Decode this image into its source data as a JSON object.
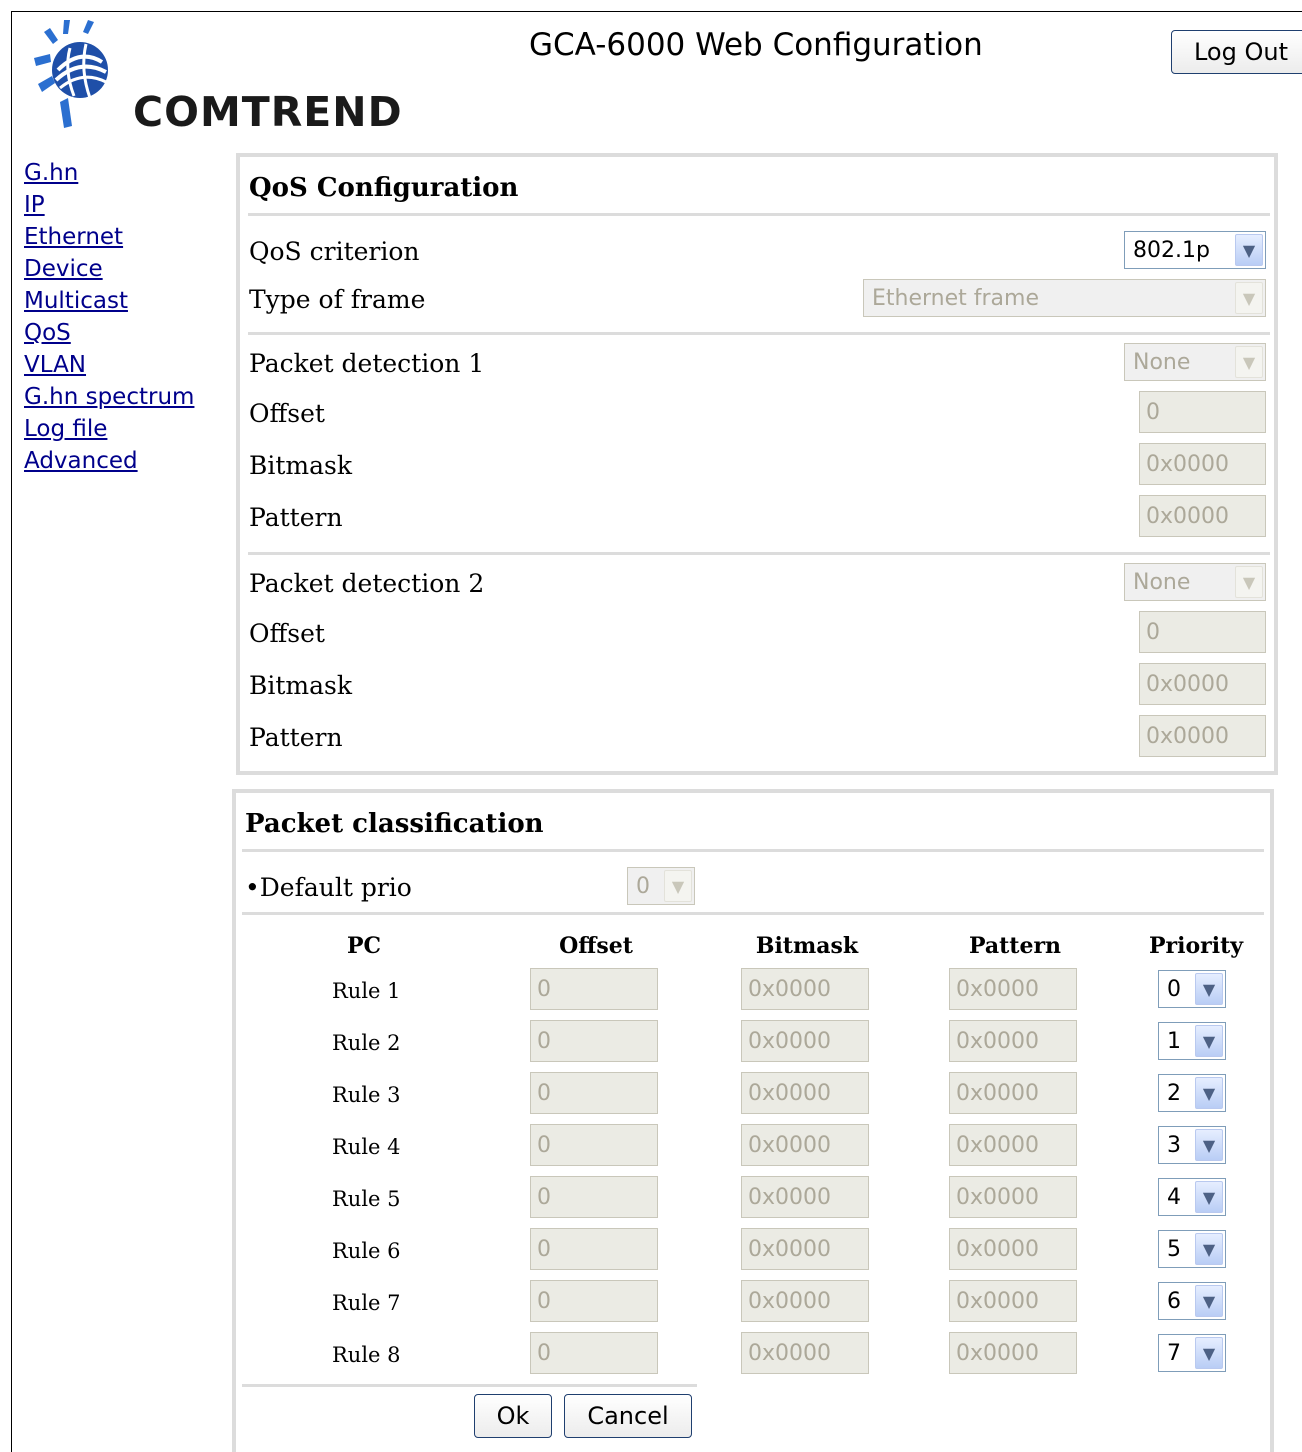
{
  "header": {
    "app_title": "GCA-6000 Web Configuration",
    "logout_label": "Log Out",
    "logo_text": "COMTREND"
  },
  "nav": [
    {
      "label": "G.hn"
    },
    {
      "label": "IP"
    },
    {
      "label": "Ethernet"
    },
    {
      "label": "Device"
    },
    {
      "label": "Multicast"
    },
    {
      "label": "QoS"
    },
    {
      "label": "VLAN"
    },
    {
      "label": "G.hn spectrum"
    },
    {
      "label": "Log file"
    },
    {
      "label": "Advanced"
    }
  ],
  "qos": {
    "title": "QoS Configuration",
    "criterion_label": "QoS criterion",
    "criterion_value": "802.1p",
    "frame_label": "Type of frame",
    "frame_value": "Ethernet frame",
    "pd1": {
      "label": "Packet detection 1",
      "value": "None",
      "offset_label": "Offset",
      "offset": "0",
      "bitmask_label": "Bitmask",
      "bitmask": "0x0000",
      "pattern_label": "Pattern",
      "pattern": "0x0000"
    },
    "pd2": {
      "label": "Packet detection 2",
      "value": "None",
      "offset_label": "Offset",
      "offset": "0",
      "bitmask_label": "Bitmask",
      "bitmask": "0x0000",
      "pattern_label": "Pattern",
      "pattern": "0x0000"
    }
  },
  "classification": {
    "title": "Packet classification",
    "default_prio_label": "•Default prio",
    "default_prio_value": "0",
    "headers": {
      "pc": "PC",
      "offset": "Offset",
      "bitmask": "Bitmask",
      "pattern": "Pattern",
      "priority": "Priority"
    },
    "rules": [
      {
        "label": "Rule 1",
        "offset": "0",
        "bitmask": "0x0000",
        "pattern": "0x0000",
        "priority": "0"
      },
      {
        "label": "Rule 2",
        "offset": "0",
        "bitmask": "0x0000",
        "pattern": "0x0000",
        "priority": "1"
      },
      {
        "label": "Rule 3",
        "offset": "0",
        "bitmask": "0x0000",
        "pattern": "0x0000",
        "priority": "2"
      },
      {
        "label": "Rule 4",
        "offset": "0",
        "bitmask": "0x0000",
        "pattern": "0x0000",
        "priority": "3"
      },
      {
        "label": "Rule 5",
        "offset": "0",
        "bitmask": "0x0000",
        "pattern": "0x0000",
        "priority": "4"
      },
      {
        "label": "Rule 6",
        "offset": "0",
        "bitmask": "0x0000",
        "pattern": "0x0000",
        "priority": "5"
      },
      {
        "label": "Rule 7",
        "offset": "0",
        "bitmask": "0x0000",
        "pattern": "0x0000",
        "priority": "6"
      },
      {
        "label": "Rule 8",
        "offset": "0",
        "bitmask": "0x0000",
        "pattern": "0x0000",
        "priority": "7"
      }
    ]
  },
  "buttons": {
    "ok": "Ok",
    "cancel": "Cancel"
  },
  "icons": {
    "dropdown": "chevron-down-icon",
    "logo": "comtrend-logo-icon"
  },
  "colors": {
    "nav_link": "#00008b",
    "panel_border": "#dcdcdc",
    "logo_blue": "#1f4fa8"
  }
}
